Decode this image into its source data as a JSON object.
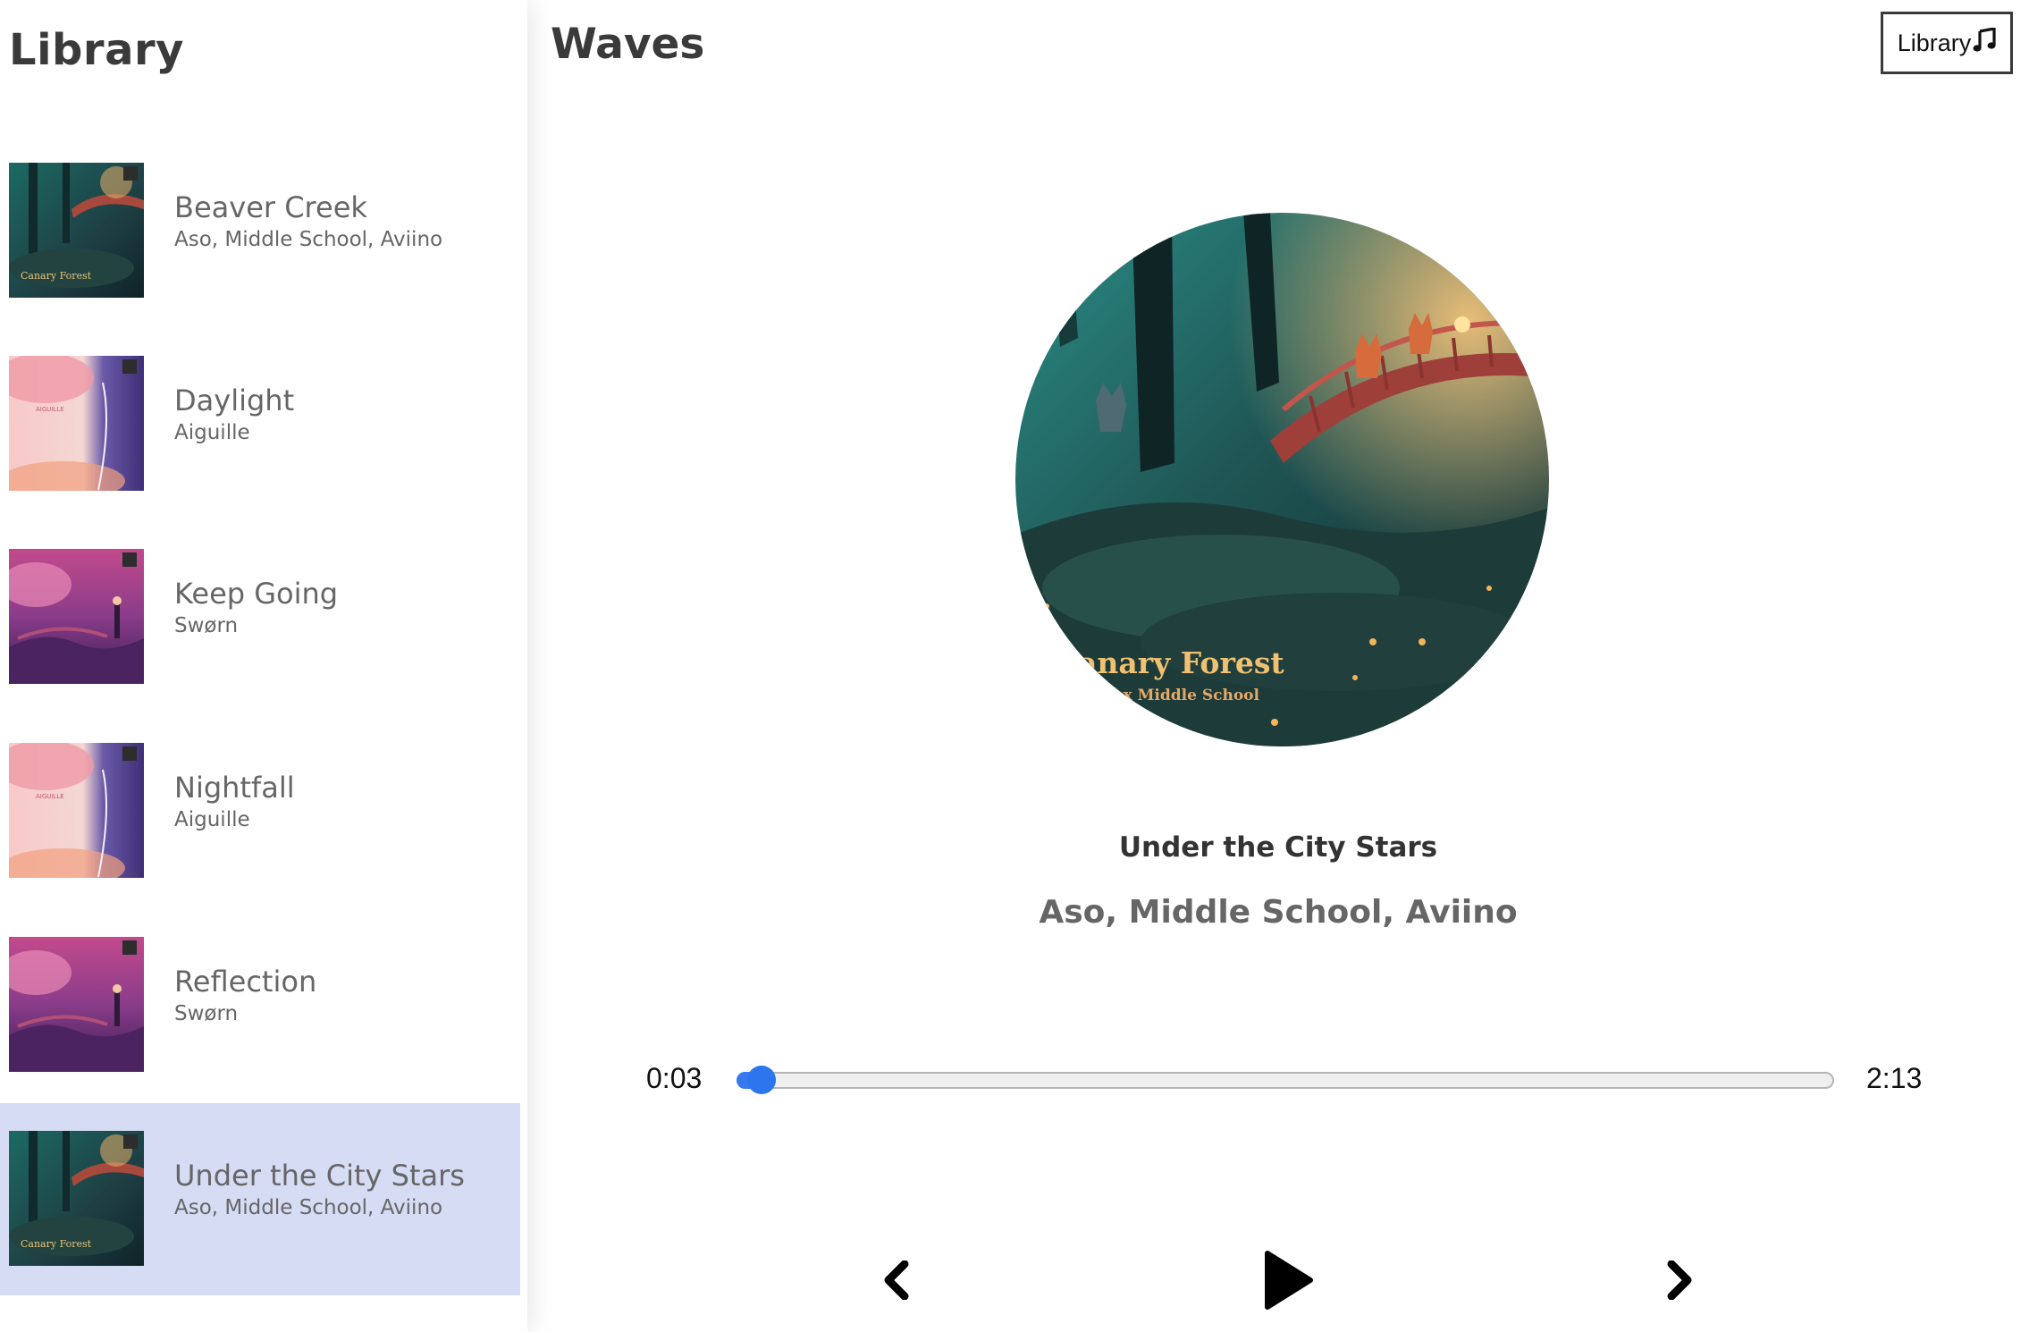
{
  "sidebar": {
    "title": "Library",
    "songs": [
      {
        "name": "Beaver Creek",
        "artist": "Aso, Middle School, Aviino",
        "cover": "canary-forest-cover",
        "active": false
      },
      {
        "name": "Daylight",
        "artist": "Aiguille",
        "cover": "aiguille-pink-cover",
        "active": false
      },
      {
        "name": "Keep Going",
        "artist": "Swørn",
        "cover": "purple-dusk-cover",
        "active": false
      },
      {
        "name": "Nightfall",
        "artist": "Aiguille",
        "cover": "aiguille-pink-cover",
        "active": false
      },
      {
        "name": "Reflection",
        "artist": "Swørn",
        "cover": "purple-dusk-cover",
        "active": false
      },
      {
        "name": "Under the City Stars",
        "artist": "Aso, Middle School, Aviino",
        "cover": "canary-forest-cover",
        "active": true
      }
    ]
  },
  "header": {
    "logo": "Waves",
    "library_button_label": "Library",
    "library_button_icon": "music-note-icon"
  },
  "player": {
    "cover": "canary-forest-cover",
    "cover_text_line1": "anary Forest",
    "cover_text_line2": "iino x Middle School",
    "song_name": "Under the City Stars",
    "artist": "Aso, Middle School, Aviino",
    "current_time": "0:03",
    "total_time": "2:13",
    "progress_fraction": 0.0226,
    "accent_color": "#3578f0",
    "controls": {
      "prev_icon": "chevron-left-icon",
      "play_icon": "play-icon",
      "next_icon": "chevron-right-icon"
    }
  },
  "colors": {
    "active_item_bg": "#d6dcf4",
    "text_dark": "#3a3a3a",
    "text_muted": "#666666"
  }
}
